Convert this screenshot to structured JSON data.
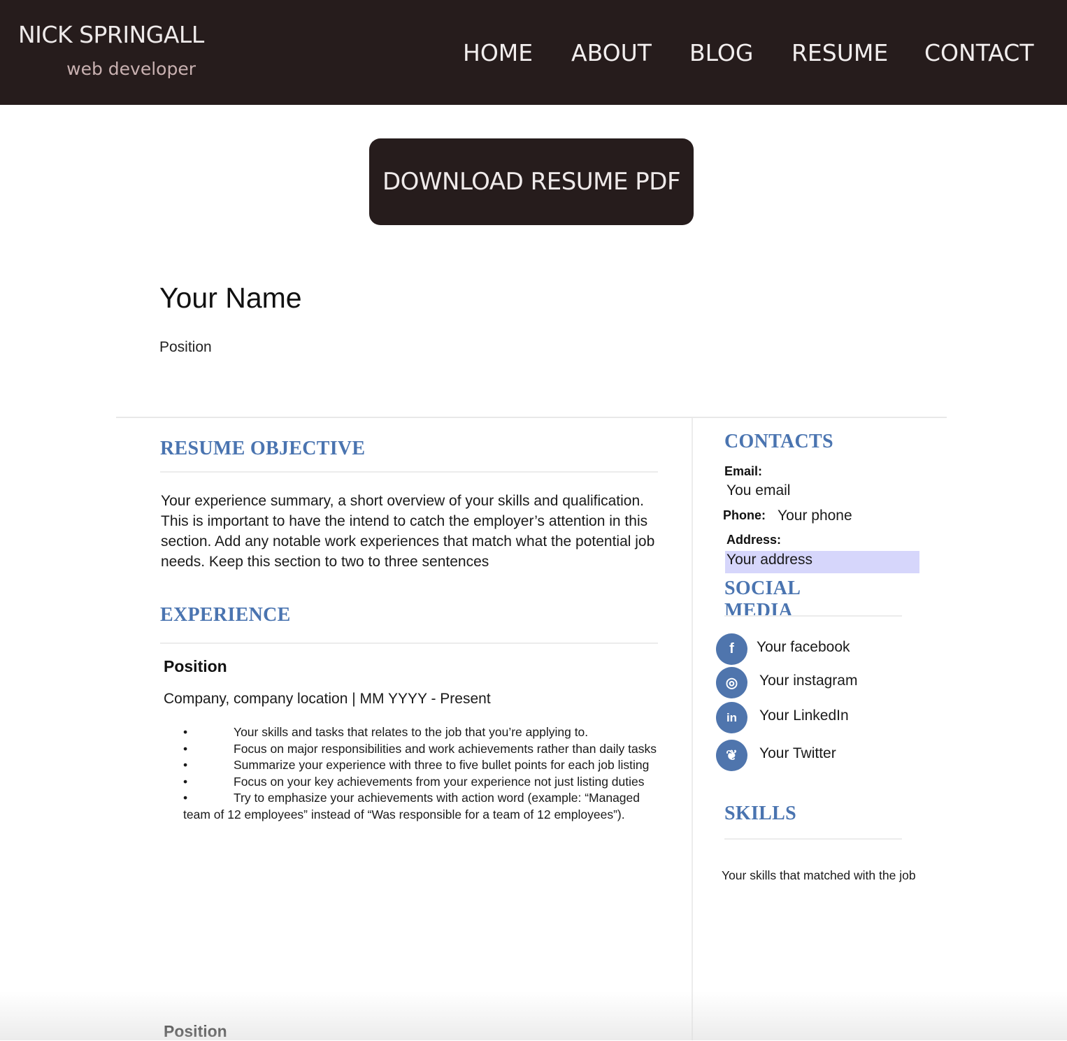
{
  "header": {
    "brand_name": "NICK SPRINGALL",
    "brand_tagline": "web developer",
    "nav": [
      "HOME",
      "ABOUT",
      "BLOG",
      "RESUME",
      "CONTACT"
    ]
  },
  "download_button_label": "DOWNLOAD RESUME PDF",
  "resume": {
    "name": "Your Name",
    "position": "Position",
    "objective": {
      "heading": "RESUME OBJECTIVE",
      "text": "Your experience summary, a short overview of your skills and qualification. This is important to have the intend to catch the employer’s attention in this section. Add any notable work experiences that match what the potential job needs. Keep this section to two to three sentences"
    },
    "experience": {
      "heading": "EXPERIENCE",
      "jobs": [
        {
          "title": "Position",
          "meta": "Company, company location | MM YYYY - Present",
          "bullets": [
            "Your skills and tasks that relates to the job that you’re applying to.",
            "Focus on major responsibilities and work achievements rather than daily tasks",
            "Summarize your experience with three to five bullet points for each job listing",
            "Focus on your key achievements from your experience not just listing duties",
            "Try to emphasize your achievements with action word (example: “Managed team of 12 employees” instead of “Was responsible for a team of 12 employees”)."
          ]
        },
        {
          "title": "Position"
        }
      ]
    },
    "contacts": {
      "heading": "CONTACTS",
      "email_label": "Email:",
      "email_value": "You email",
      "phone_label": "Phone:",
      "phone_value": "Your phone",
      "address_label": "Address:",
      "address_value": "Your address"
    },
    "social": {
      "heading_line1": "SOCIAL",
      "heading_line2": "MEDIA",
      "items": [
        {
          "label": "Your facebook",
          "icon": "facebook-icon",
          "glyph": "f"
        },
        {
          "label": "Your instagram",
          "icon": "instagram-icon",
          "glyph": "◎"
        },
        {
          "label": "Your LinkedIn",
          "icon": "linkedin-icon",
          "glyph": "in"
        },
        {
          "label": "Your Twitter",
          "icon": "twitter-icon",
          "glyph": "❦"
        }
      ]
    },
    "skills": {
      "heading": "SKILLS",
      "text": "Your skills that matched with the job"
    }
  },
  "colors": {
    "header_bg": "#261c1c",
    "section_heading": "#4a74b0",
    "social_icon_bg": "#4f75ad",
    "address_highlight": "#d6d6fb"
  }
}
